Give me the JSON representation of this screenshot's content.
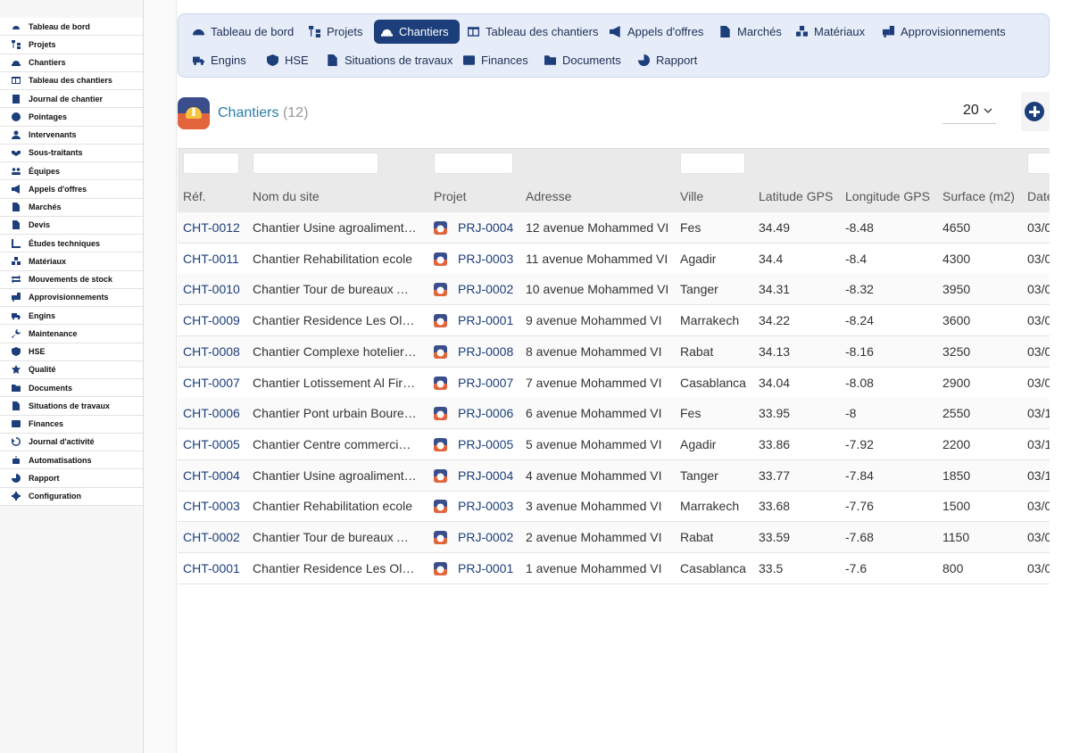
{
  "sidebar": {
    "items": [
      {
        "label": "Tableau de bord",
        "icon": "dashboard-icon"
      },
      {
        "label": "Projets",
        "icon": "project-tree-icon"
      },
      {
        "label": "Chantiers",
        "icon": "hardhat-icon"
      },
      {
        "label": "Tableau des chantiers",
        "icon": "table-icon"
      },
      {
        "label": "Journal de chantier",
        "icon": "journal-icon"
      },
      {
        "label": "Pointages",
        "icon": "clock-icon"
      },
      {
        "label": "Intervenants",
        "icon": "worker-icon"
      },
      {
        "label": "Sous-traitants",
        "icon": "handshake-icon"
      },
      {
        "label": "Équipes",
        "icon": "team-icon"
      },
      {
        "label": "Appels d'offres",
        "icon": "megaphone-icon"
      },
      {
        "label": "Marchés",
        "icon": "contract-icon"
      },
      {
        "label": "Devis",
        "icon": "quote-icon"
      },
      {
        "label": "Études techniques",
        "icon": "ruler-icon"
      },
      {
        "label": "Matériaux",
        "icon": "cubes-icon"
      },
      {
        "label": "Mouvements de stock",
        "icon": "exchange-icon"
      },
      {
        "label": "Approvisionnements",
        "icon": "truck-loading-icon"
      },
      {
        "label": "Engins",
        "icon": "truck-icon"
      },
      {
        "label": "Maintenance",
        "icon": "wrench-icon"
      },
      {
        "label": "HSE",
        "icon": "shield-icon"
      },
      {
        "label": "Qualité",
        "icon": "badge-icon"
      },
      {
        "label": "Documents",
        "icon": "folder-icon"
      },
      {
        "label": "Situations de travaux",
        "icon": "invoice-icon"
      },
      {
        "label": "Finances",
        "icon": "wallet-icon"
      },
      {
        "label": "Journal d'activité",
        "icon": "history-icon"
      },
      {
        "label": "Automatisations",
        "icon": "robot-icon"
      },
      {
        "label": "Rapport",
        "icon": "chart-pie-icon"
      },
      {
        "label": "Configuration",
        "icon": "gear-icon"
      }
    ]
  },
  "topnav": {
    "row1": [
      {
        "label": "Tableau de bord",
        "icon": "dashboard-icon"
      },
      {
        "label": "Projets",
        "icon": "project-tree-icon"
      },
      {
        "label": "Chantiers",
        "icon": "hardhat-icon",
        "active": true
      },
      {
        "label": "Tableau des chantiers",
        "icon": "table-icon"
      },
      {
        "label": "Appels d'offres",
        "icon": "megaphone-icon"
      },
      {
        "label": "Marchés",
        "icon": "contract-icon"
      },
      {
        "label": "Matériaux",
        "icon": "cubes-icon"
      },
      {
        "label": "Approvisionnements",
        "icon": "truck-loading-icon"
      }
    ],
    "row2": [
      {
        "label": "Engins",
        "icon": "truck-icon"
      },
      {
        "label": "HSE",
        "icon": "shield-icon"
      },
      {
        "label": "Situations de travaux",
        "icon": "invoice-icon"
      },
      {
        "label": "Finances",
        "icon": "wallet-icon"
      },
      {
        "label": "Documents",
        "icon": "folder-icon"
      },
      {
        "label": "Rapport",
        "icon": "chart-pie-icon"
      }
    ]
  },
  "page": {
    "title": "Chantiers",
    "count": "(12)",
    "per_page": "20"
  },
  "table": {
    "columns": [
      "Réf.",
      "Nom du site",
      "Projet",
      "Adresse",
      "Ville",
      "Latitude GPS",
      "Longitude GPS",
      "Surface (m2)",
      "Date"
    ],
    "rows": [
      {
        "ref": "CHT-0012",
        "name": "Chantier Usine agroalimentaire",
        "project": "PRJ-0004",
        "address": "12 avenue Mohammed VI",
        "city": "Fes",
        "lat": "34.49",
        "lng": "-8.48",
        "surface": "4650",
        "date": "03/0"
      },
      {
        "ref": "CHT-0011",
        "name": "Chantier Rehabilitation ecole",
        "project": "PRJ-0003",
        "address": "11 avenue Mohammed VI",
        "city": "Agadir",
        "lat": "34.4",
        "lng": "-8.4",
        "surface": "4300",
        "date": "03/0"
      },
      {
        "ref": "CHT-0010",
        "name": "Chantier Tour de bureaux Anfa",
        "project": "PRJ-0002",
        "address": "10 avenue Mohammed VI",
        "city": "Tanger",
        "lat": "34.31",
        "lng": "-8.32",
        "surface": "3950",
        "date": "03/0"
      },
      {
        "ref": "CHT-0009",
        "name": "Chantier Residence Les Oliviers",
        "project": "PRJ-0001",
        "address": "9 avenue Mohammed VI",
        "city": "Marrakech",
        "lat": "34.22",
        "lng": "-8.24",
        "surface": "3600",
        "date": "03/0"
      },
      {
        "ref": "CHT-0008",
        "name": "Chantier Complexe hotelier Atlas",
        "project": "PRJ-0008",
        "address": "8 avenue Mohammed VI",
        "city": "Rabat",
        "lat": "34.13",
        "lng": "-8.16",
        "surface": "3250",
        "date": "03/0"
      },
      {
        "ref": "CHT-0007",
        "name": "Chantier Lotissement Al Firdaous",
        "project": "PRJ-0007",
        "address": "7 avenue Mohammed VI",
        "city": "Casablanca",
        "lat": "34.04",
        "lng": "-8.08",
        "surface": "2900",
        "date": "03/0"
      },
      {
        "ref": "CHT-0006",
        "name": "Chantier Pont urbain Bouregreg",
        "project": "PRJ-0006",
        "address": "6 avenue Mohammed VI",
        "city": "Fes",
        "lat": "33.95",
        "lng": "-8",
        "surface": "2550",
        "date": "03/1"
      },
      {
        "ref": "CHT-0005",
        "name": "Chantier Centre commercial Marina",
        "project": "PRJ-0005",
        "address": "5 avenue Mohammed VI",
        "city": "Agadir",
        "lat": "33.86",
        "lng": "-7.92",
        "surface": "2200",
        "date": "03/1"
      },
      {
        "ref": "CHT-0004",
        "name": "Chantier Usine agroalimentaire",
        "project": "PRJ-0004",
        "address": "4 avenue Mohammed VI",
        "city": "Tanger",
        "lat": "33.77",
        "lng": "-7.84",
        "surface": "1850",
        "date": "03/1"
      },
      {
        "ref": "CHT-0003",
        "name": "Chantier Rehabilitation ecole",
        "project": "PRJ-0003",
        "address": "3 avenue Mohammed VI",
        "city": "Marrakech",
        "lat": "33.68",
        "lng": "-7.76",
        "surface": "1500",
        "date": "03/0"
      },
      {
        "ref": "CHT-0002",
        "name": "Chantier Tour de bureaux Anfa",
        "project": "PRJ-0002",
        "address": "2 avenue Mohammed VI",
        "city": "Rabat",
        "lat": "33.59",
        "lng": "-7.68",
        "surface": "1150",
        "date": "03/0"
      },
      {
        "ref": "CHT-0001",
        "name": "Chantier Residence Les Oliviers",
        "project": "PRJ-0001",
        "address": "1 avenue Mohammed VI",
        "city": "Casablanca",
        "lat": "33.5",
        "lng": "-7.6",
        "surface": "800",
        "date": "03/0"
      }
    ]
  },
  "colors": {
    "brand": "#1c3e7a",
    "title": "#2a7ea6",
    "nav_bg": "#e6edf9"
  }
}
